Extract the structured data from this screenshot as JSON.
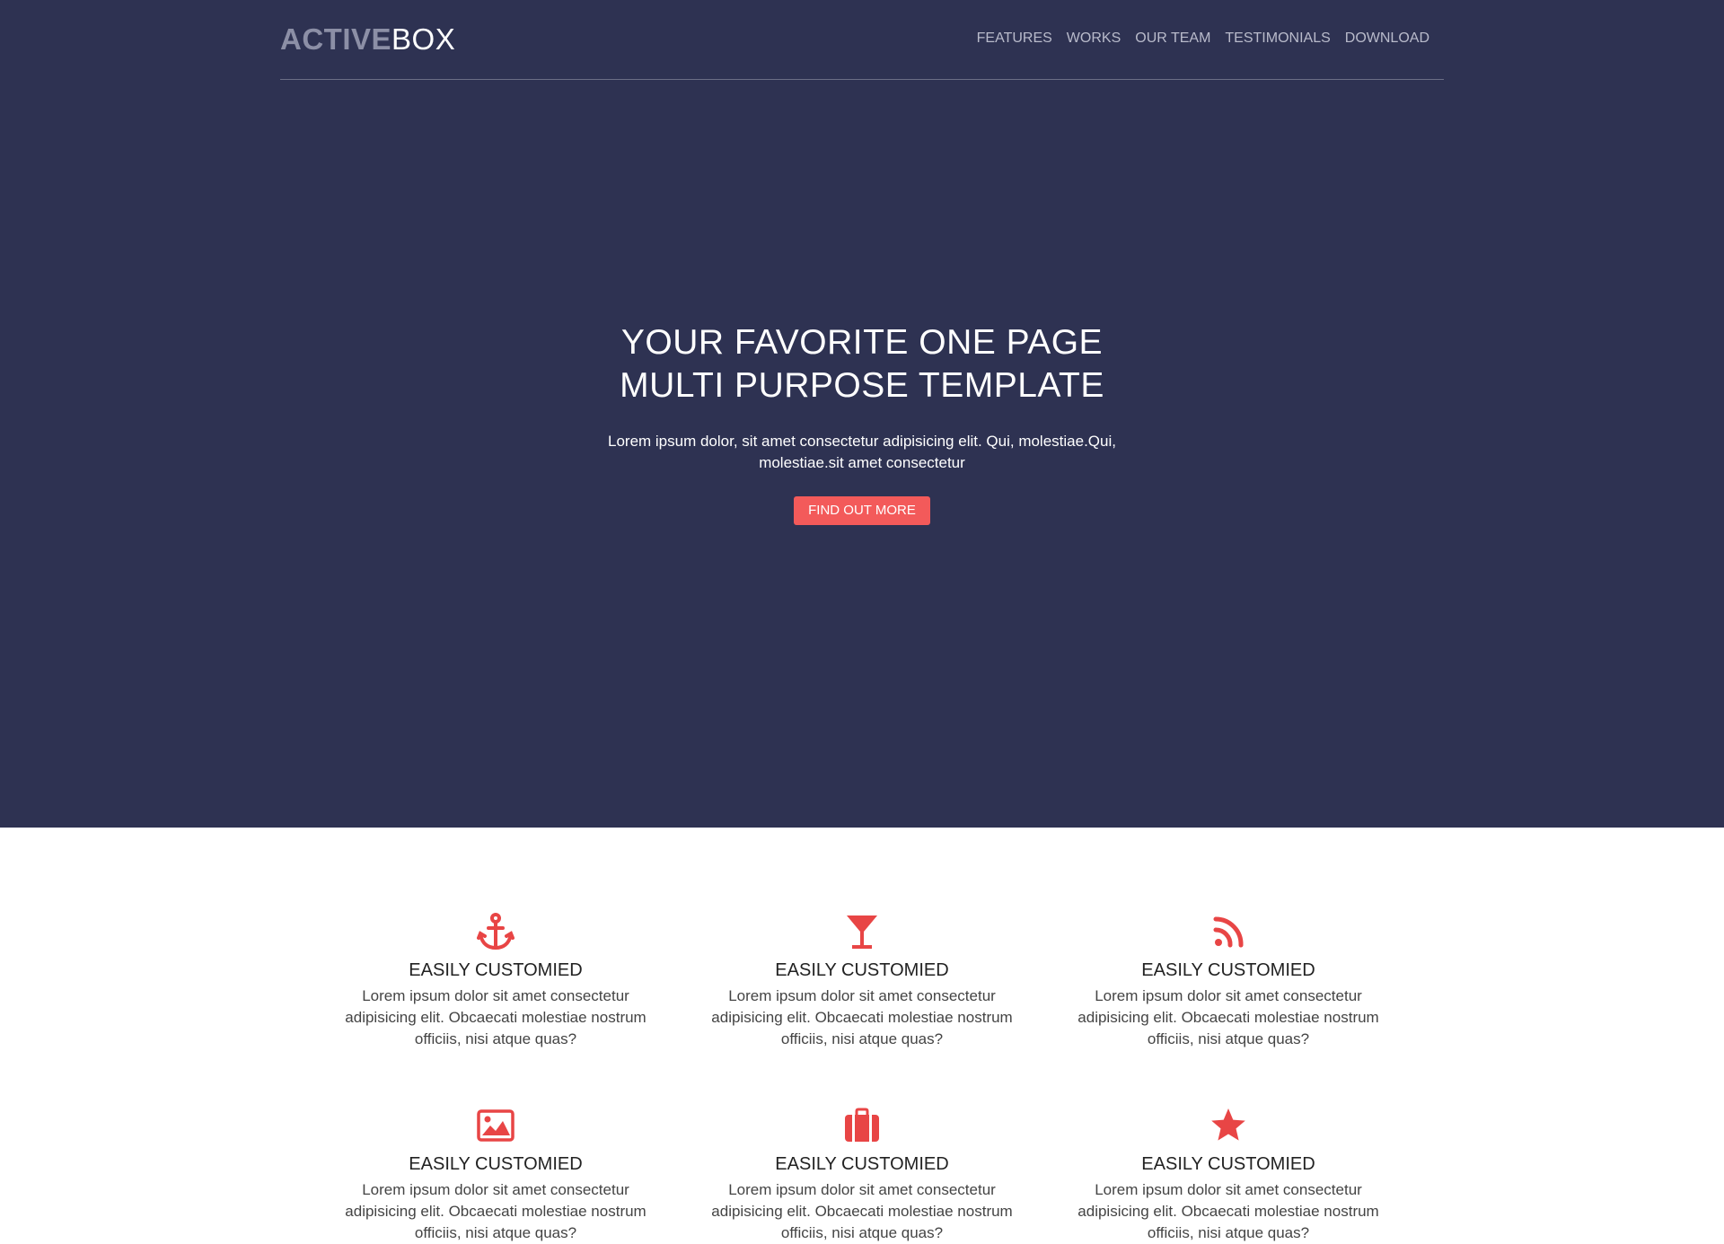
{
  "brand": {
    "bold": "ACTIVE",
    "light": "BOX"
  },
  "nav": {
    "items": [
      "FEATURES",
      "WORKS",
      "OUR TEAM",
      "TESTIMONIALS",
      "DOWNLOAD"
    ]
  },
  "hero": {
    "title_line1": "YOUR FAVORITE ONE PAGE",
    "title_line2": "MULTI PURPOSE TEMPLATE",
    "subtitle": "Lorem ipsum dolor, sit amet consectetur adipisicing elit. Qui, molestiae.Qui, molestiae.sit amet consectetur",
    "cta_label": "FIND OUT MORE"
  },
  "colors": {
    "hero_bg": "#2e3252",
    "accent": "#f35a5a",
    "icon": "#e84545"
  },
  "features": [
    {
      "icon": "anchor-icon",
      "title": "EASILY CUSTOMIED",
      "text": "Lorem ipsum dolor sit amet consectetur adipisicing elit. Obcaecati molestiae nostrum officiis, nisi atque quas?"
    },
    {
      "icon": "cocktail-icon",
      "title": "EASILY CUSTOMIED",
      "text": "Lorem ipsum dolor sit amet consectetur adipisicing elit. Obcaecati molestiae nostrum officiis, nisi atque quas?"
    },
    {
      "icon": "rss-icon",
      "title": "EASILY CUSTOMIED",
      "text": "Lorem ipsum dolor sit amet consectetur adipisicing elit. Obcaecati molestiae nostrum officiis, nisi atque quas?"
    },
    {
      "icon": "image-icon",
      "title": "EASILY CUSTOMIED",
      "text": "Lorem ipsum dolor sit amet consectetur adipisicing elit. Obcaecati molestiae nostrum officiis, nisi atque quas?"
    },
    {
      "icon": "briefcase-icon",
      "title": "EASILY CUSTOMIED",
      "text": "Lorem ipsum dolor sit amet consectetur adipisicing elit. Obcaecati molestiae nostrum officiis, nisi atque quas?"
    },
    {
      "icon": "star-icon",
      "title": "EASILY CUSTOMIED",
      "text": "Lorem ipsum dolor sit amet consectetur adipisicing elit. Obcaecati molestiae nostrum officiis, nisi atque quas?"
    }
  ]
}
